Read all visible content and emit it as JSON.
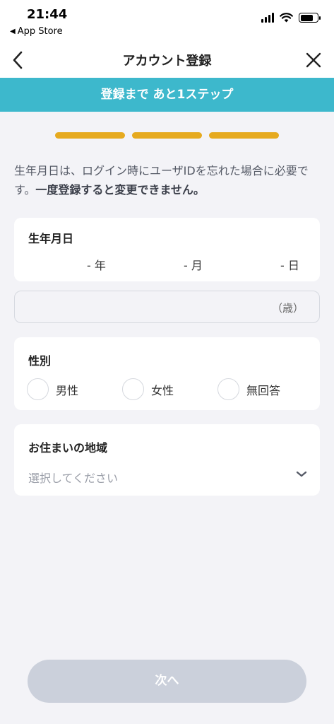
{
  "status_bar": {
    "time": "21:44",
    "back_app": "App Store"
  },
  "nav": {
    "title": "アカウント登録"
  },
  "banner": {
    "text": "登録まで あと1ステップ"
  },
  "progress": {
    "steps_total": 3,
    "steps_completed": 3,
    "color": "#e6aa1f"
  },
  "description": {
    "normal": "生年月日は、ログイン時にユーザIDを忘れた場合に必要です。",
    "emphasis": "一度登録すると変更できません。"
  },
  "birthdate": {
    "label": "生年月日",
    "year": "- 年",
    "month": "- 月",
    "day": "- 日"
  },
  "age": {
    "unit": "（歳）"
  },
  "gender": {
    "label": "性別",
    "options": [
      "男性",
      "女性",
      "無回答"
    ]
  },
  "region": {
    "label": "お住まいの地域",
    "placeholder": "選択してください"
  },
  "next_button": {
    "label": "次へ"
  },
  "colors": {
    "banner": "#3db8cc",
    "button_disabled": "#cbd0db",
    "background": "#f3f3f7"
  }
}
